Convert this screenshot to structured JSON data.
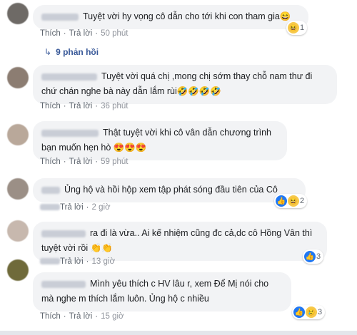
{
  "comments": [
    {
      "text": "Tuyệt vời hy vọng cô dẫn cho tới khi con tham gia😄",
      "actions": {
        "like": "Thích",
        "reply": "Trả lời",
        "time": "50 phút"
      },
      "reaction_count": "1",
      "reaction_icons": [
        "haha-icon"
      ]
    },
    {
      "text": "Tuyệt vời quá chị ,mong chị sớm thay chỗ nam thư đi chứ chán nghe bà này dẫn lắm rùi🤣🤣🤣🤣",
      "actions": {
        "like": "Thích",
        "reply": "Trả lời",
        "time": "36 phút"
      }
    },
    {
      "text": "Thật tuyệt vời khi cô vân dẫn chương trình bạn muốn hẹn hò 😍😍😍",
      "actions": {
        "like": "Thích",
        "reply": "Trả lời",
        "time": "59 phút"
      }
    },
    {
      "text": "Ủng hộ và hồi hộp xem tập phát sóng đầu tiên của Cô",
      "actions": {
        "like": "",
        "reply": "Trả lời",
        "time": "2 giờ"
      },
      "reaction_count": "2",
      "reaction_icons": [
        "like-icon",
        "haha-icon"
      ]
    },
    {
      "text": "ra đi là vừa.. Ai kế nhiệm cũng đc cả,dc cô Hồng Vân thì tuyệt vời rồi 👏👏",
      "actions": {
        "like": "",
        "reply": "Trả lời",
        "time": "13 giờ"
      },
      "reaction_count": "3",
      "reaction_icons": [
        "like-icon"
      ]
    },
    {
      "text": "Mình yêu thích c HV lâu r, xem Để Mị nói cho mà nghe m thích lắm luôn. Ủng hộ c nhiều",
      "actions": {
        "like": "Thích",
        "reply": "Trả lời",
        "time": "15 giờ"
      },
      "reaction_count": "3",
      "reaction_icons": [
        "like-icon",
        "sad-icon"
      ]
    }
  ],
  "replies_link": "9 phản hồi",
  "colors": {
    "bubble": "#f2f3f5",
    "link": "#385898",
    "meta": "#606770",
    "like": "#2078f4"
  }
}
